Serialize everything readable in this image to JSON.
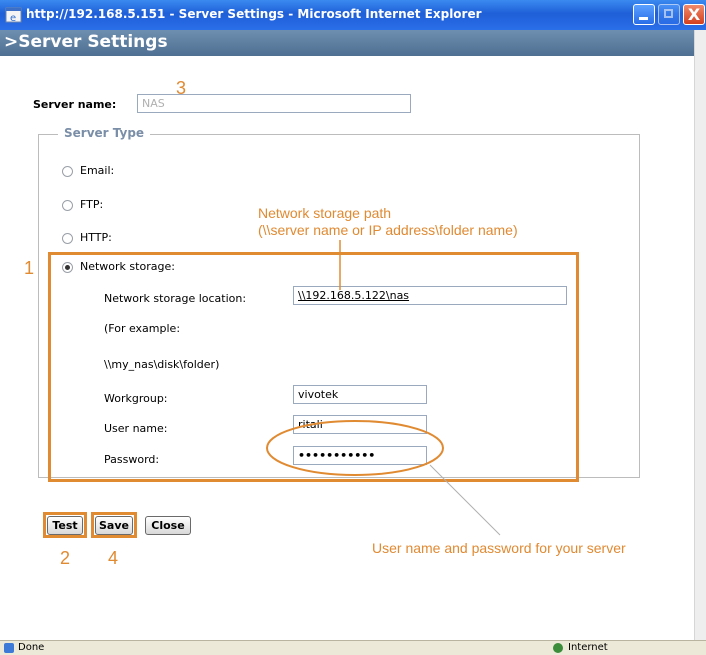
{
  "window": {
    "title": "http://192.168.5.151 - Server Settings - Microsoft Internet Explorer",
    "close_glyph": "X"
  },
  "page": {
    "header": ">Server Settings"
  },
  "server_name": {
    "label": "Server name:",
    "placeholder": "NAS"
  },
  "server_type": {
    "legend": "Server Type",
    "options": [
      {
        "label": "Email:",
        "checked": false
      },
      {
        "label": "FTP:",
        "checked": false
      },
      {
        "label": "HTTP:",
        "checked": false
      },
      {
        "label": "Network storage:",
        "checked": true
      }
    ]
  },
  "network_storage": {
    "location_label": "Network storage location:",
    "location_value": "\\\\192.168.5.122\\nas",
    "example_label": "(For example:",
    "example_value": "\\\\my_nas\\disk\\folder)",
    "workgroup_label": "Workgroup:",
    "workgroup_value": "vivotek",
    "username_label": "User name:",
    "username_value": "ritali",
    "password_label": "Password:",
    "password_value": "•••••••••••"
  },
  "buttons": {
    "test": "Test",
    "save": "Save",
    "close": "Close"
  },
  "statusbar": {
    "done": "Done",
    "zone": "Internet"
  },
  "annotations": {
    "num1": "1",
    "num2": "2",
    "num3": "3",
    "num4": "4",
    "path_line1": "Network storage path",
    "path_line2": "(\\\\server name or IP address\\folder name)",
    "credentials": "User name and password for your server",
    "color": "#e08a32"
  }
}
